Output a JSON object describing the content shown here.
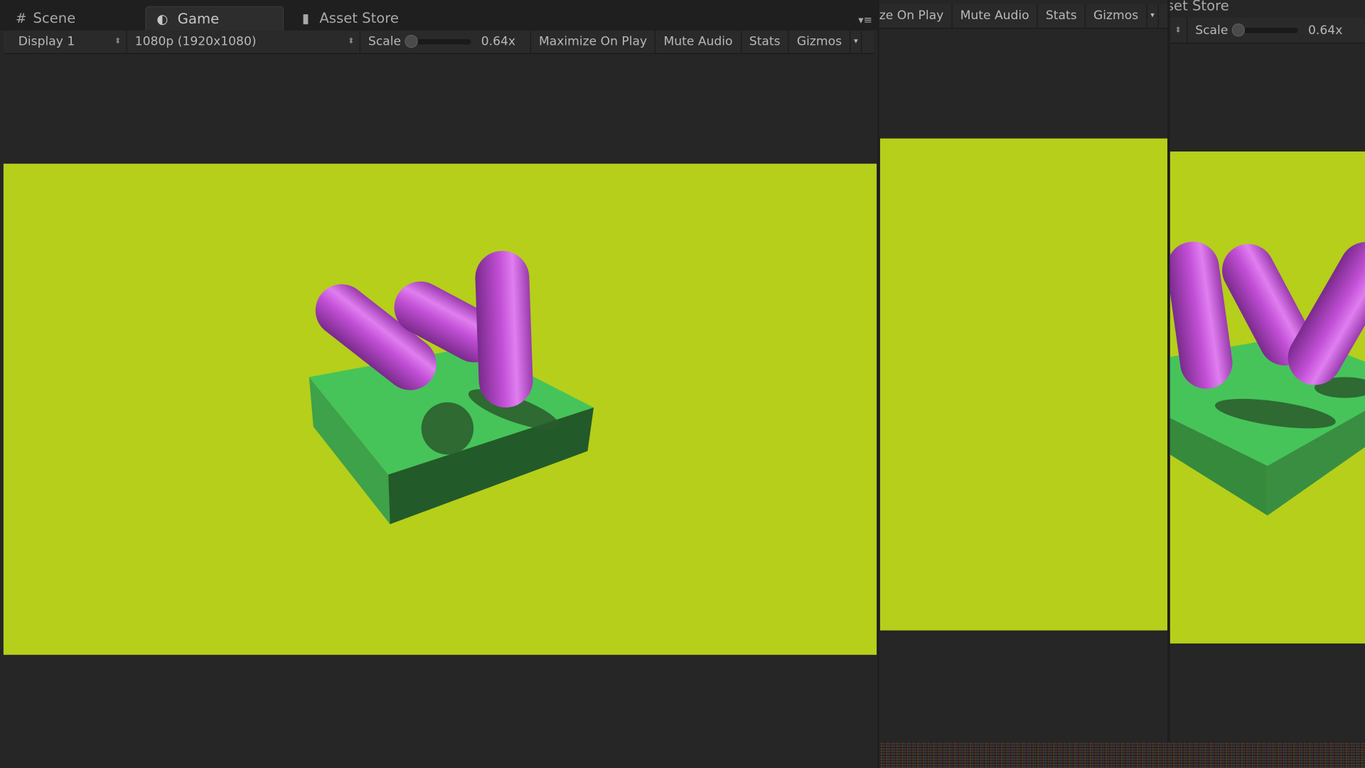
{
  "left_panel": {
    "tabs": [
      {
        "label": "Scene",
        "icon": "grid-icon"
      },
      {
        "label": "Game",
        "icon": "pacman-icon",
        "active": true
      },
      {
        "label": "Asset Store",
        "icon": "bag-icon"
      }
    ],
    "toolbar": {
      "display": "Display 1",
      "resolution": "1080p (1920x1080)",
      "scale_label": "Scale",
      "scale_value": "0.64x",
      "maximize": "Maximize On Play",
      "mute": "Mute Audio",
      "stats": "Stats",
      "gizmos": "Gizmos"
    }
  },
  "middle_panel": {
    "toolbar": {
      "maximize": "ze On Play",
      "mute": "Mute Audio",
      "stats": "Stats",
      "gizmos": "Gizmos"
    }
  },
  "right_panel": {
    "tab": "set Store",
    "toolbar": {
      "scale_label": "Scale",
      "scale_value": "0.64x"
    }
  },
  "colors": {
    "background": "#b5cf1b",
    "platform": "#46c45a",
    "capsule": "#c04ad0"
  }
}
